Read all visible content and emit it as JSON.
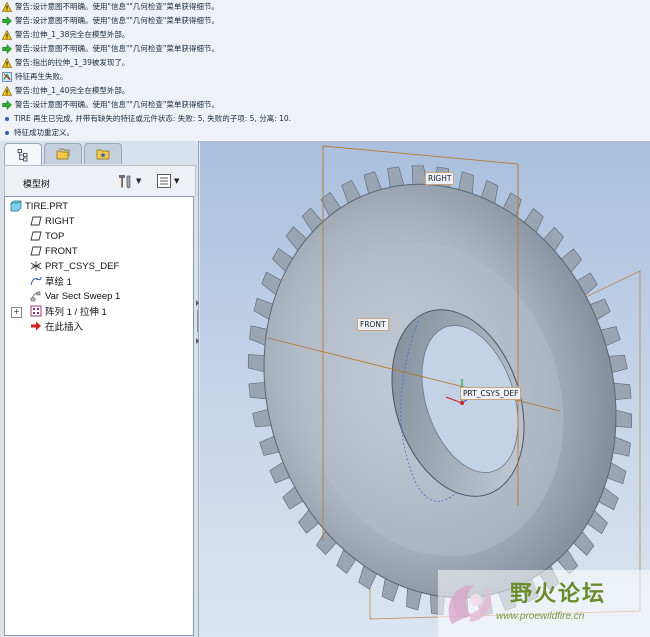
{
  "messages": [
    {
      "icon": "warning-icon",
      "text": "警告:设计意图不明确。使用\"信息\"\"几何检查\"菜单获得细节。"
    },
    {
      "icon": "arrow-right-icon",
      "text": "警告:设计意图不明确。使用\"信息\"\"几何检查\"菜单获得细节。"
    },
    {
      "icon": "warning-icon",
      "text": "警告:拉伸_1_38完全在模型外部。"
    },
    {
      "icon": "arrow-right-icon",
      "text": "警告:设计意图不明确。使用\"信息\"\"几何检查\"菜单获得细节。"
    },
    {
      "icon": "warning-icon",
      "text": "警告:指出的拉伸_1_39被发现了。"
    },
    {
      "icon": "regen-failed-icon",
      "text": "特征再生失败。"
    },
    {
      "icon": "warning-icon",
      "text": "警告:拉伸_1_40完全在模型外部。"
    },
    {
      "icon": "arrow-right-icon",
      "text": "警告:设计意图不明确。使用\"信息\"\"几何检查\"菜单获得细节。"
    },
    {
      "icon": "bullet-icon",
      "text": "TIRE 再生已完成, 并带有缺失的特征或元件状态: 失败: 5, 失败的子项: 5, 分离: 10."
    },
    {
      "icon": "bullet-icon",
      "text": "特征成功重定义。"
    }
  ],
  "panel": {
    "tabs": [
      "model-tree-tab",
      "folder-browser-tab",
      "favorites-tab"
    ],
    "title": "模型树",
    "settings_icon": "tree-settings-icon",
    "show_icon": "tree-show-icon"
  },
  "tree": [
    {
      "label": "TIRE.PRT",
      "icon": "part-icon"
    },
    {
      "label": "RIGHT",
      "icon": "datum-plane-icon"
    },
    {
      "label": "TOP",
      "icon": "datum-plane-icon"
    },
    {
      "label": "FRONT",
      "icon": "datum-plane-icon"
    },
    {
      "label": "PRT_CSYS_DEF",
      "icon": "csys-icon"
    },
    {
      "label": "草绘 1",
      "icon": "sketch-icon"
    },
    {
      "label": "Var Sect Sweep 1",
      "icon": "sweep-icon"
    },
    {
      "label": "阵列 1 / 拉伸 1",
      "icon": "pattern-icon",
      "expandable": true
    },
    {
      "label": "在此插入",
      "icon": "insert-here-icon"
    }
  ],
  "viewport": {
    "labels": {
      "right": "RIGHT",
      "front": "FRONT",
      "csys": "PRT_CSYS_DEF"
    }
  },
  "watermark": {
    "cn": "野火论坛",
    "url": "www.proewildfire.cn"
  },
  "colors": {
    "tire": "#a4afbd",
    "datum_plane": "#b57a34",
    "accent": "#2d62b7"
  }
}
